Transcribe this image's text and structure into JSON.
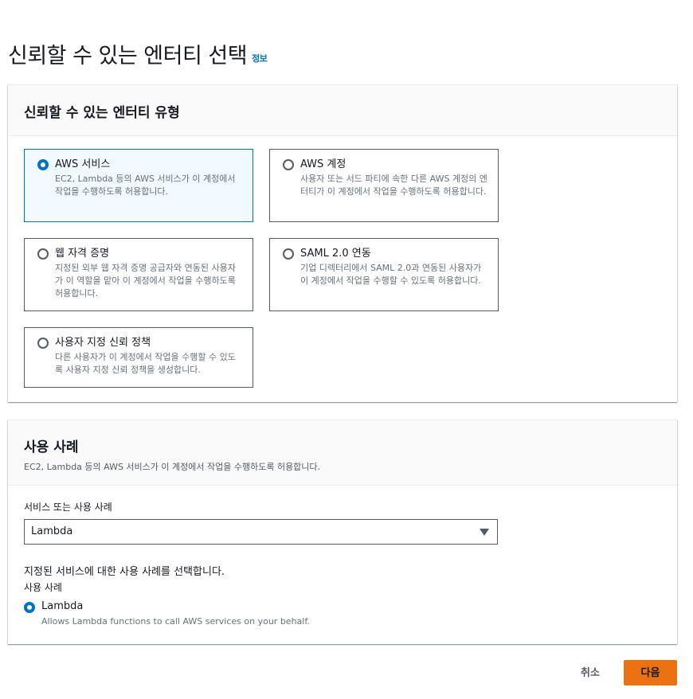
{
  "page": {
    "title": "신뢰할 수 있는 엔터티 선택",
    "info_link": "정보"
  },
  "entity_type_panel": {
    "title": "신뢰할 수 있는 엔터티 유형",
    "tiles": [
      {
        "title": "AWS 서비스",
        "description": "EC2, Lambda 등의 AWS 서비스가 이 계정에서 작업을 수행하도록 허용합니다.",
        "selected": true
      },
      {
        "title": "AWS 계정",
        "description": "사용자 또는 서드 파티에 속한 다른 AWS 계정의 엔터티가 이 계정에서 작업을 수행하도록 허용합니다.",
        "selected": false
      },
      {
        "title": "웹 자격 증명",
        "description": "지정된 외부 웹 자격 증명 공급자와 연동된 사용자가 이 역할을 맡아 이 계정에서 작업을 수행하도록 허용합니다.",
        "selected": false
      },
      {
        "title": "SAML 2.0 연동",
        "description": "기업 디렉터리에서 SAML 2.0과 연동된 사용자가 이 계정에서 작업을 수행할 수 있도록 허용합니다.",
        "selected": false
      },
      {
        "title": "사용자 지정 신뢰 정책",
        "description": "다른 사용자가 이 계정에서 작업을 수행할 수 있도록 사용자 지정 신뢰 정책을 생성합니다.",
        "selected": false
      }
    ]
  },
  "use_case_panel": {
    "title": "사용 사례",
    "description": "EC2, Lambda 등의 AWS 서비스가 이 계정에서 작업을 수행하도록 허용합니다.",
    "service_label": "서비스 또는 사용 사례",
    "service_value": "Lambda",
    "helper_text": "지정된 서비스에 대한 사용 사례를 선택합니다.",
    "use_case_label": "사용 사례",
    "option": {
      "title": "Lambda",
      "description": "Allows Lambda functions to call AWS services on your behalf.",
      "selected": true
    }
  },
  "footer": {
    "cancel_label": "취소",
    "next_label": "다음"
  },
  "colors": {
    "accent": "#0073bb",
    "primary_button": "#ec7211",
    "selected_tile_bg": "#f1faff"
  }
}
